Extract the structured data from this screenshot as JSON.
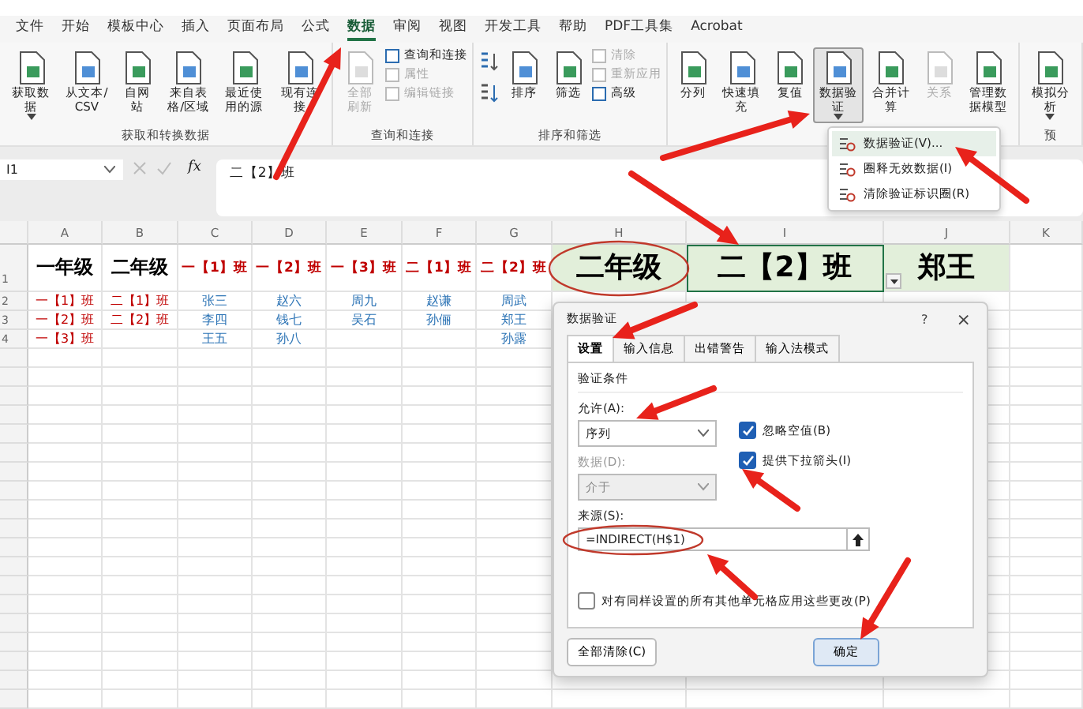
{
  "menu_tabs": [
    {
      "label": "文件",
      "selected": false
    },
    {
      "label": "开始",
      "selected": false
    },
    {
      "label": "模板中心",
      "selected": false
    },
    {
      "label": "插入",
      "selected": false
    },
    {
      "label": "页面布局",
      "selected": false
    },
    {
      "label": "公式",
      "selected": false
    },
    {
      "label": "数据",
      "selected": true
    },
    {
      "label": "审阅",
      "selected": false
    },
    {
      "label": "视图",
      "selected": false
    },
    {
      "label": "开发工具",
      "selected": false
    },
    {
      "label": "帮助",
      "selected": false
    },
    {
      "label": "PDF工具集",
      "selected": false
    },
    {
      "label": "Acrobat",
      "selected": false
    }
  ],
  "ribbon": {
    "groups": [
      {
        "label": "获取和转换数据",
        "buttons": [
          {
            "kind": "large",
            "label": "获取数据",
            "dropdown": true,
            "disabled": false,
            "selected": false
          },
          {
            "kind": "large",
            "label": "从文本/CSV",
            "dropdown": false,
            "disabled": false,
            "selected": false
          },
          {
            "kind": "large",
            "label": "自网站",
            "dropdown": false,
            "disabled": false,
            "selected": false
          },
          {
            "kind": "large",
            "label": "来自表格/区域",
            "dropdown": false,
            "disabled": false,
            "selected": false
          },
          {
            "kind": "large",
            "label": "最近使用的源",
            "dropdown": false,
            "disabled": false,
            "selected": false
          },
          {
            "kind": "large",
            "label": "现有连接",
            "dropdown": false,
            "disabled": false,
            "selected": false
          }
        ]
      },
      {
        "label": "查询和连接",
        "buttons": [
          {
            "kind": "large",
            "label": "全部刷新",
            "dropdown": false,
            "disabled": true,
            "selected": false
          },
          {
            "kind": "stack",
            "items": [
              {
                "label": "查询和连接",
                "disabled": false
              },
              {
                "label": "属性",
                "disabled": true
              },
              {
                "label": "编辑链接",
                "disabled": true
              }
            ]
          }
        ]
      },
      {
        "label": "排序和筛选",
        "buttons": [
          {
            "kind": "sort"
          },
          {
            "kind": "large",
            "label": "排序",
            "dropdown": false,
            "disabled": false,
            "selected": false
          },
          {
            "kind": "large",
            "label": "筛选",
            "dropdown": false,
            "disabled": false,
            "selected": false
          },
          {
            "kind": "stack",
            "items": [
              {
                "label": "清除",
                "disabled": true
              },
              {
                "label": "重新应用",
                "disabled": true
              },
              {
                "label": "高级",
                "disabled": false
              }
            ]
          }
        ]
      },
      {
        "buttons": [
          {
            "kind": "large",
            "label": "分列",
            "dropdown": false,
            "disabled": false,
            "selected": false
          },
          {
            "kind": "large",
            "label": "快速填充",
            "dropdown": false,
            "disabled": false,
            "selected": false
          },
          {
            "kind": "large",
            "label": "复值",
            "dropdown": false,
            "disabled": false,
            "selected": false
          },
          {
            "kind": "large",
            "label": "数据验证",
            "dropdown": true,
            "disabled": false,
            "selected": true
          },
          {
            "kind": "large",
            "label": "合并计算",
            "dropdown": false,
            "disabled": false,
            "selected": false
          },
          {
            "kind": "large",
            "label": "关系",
            "dropdown": false,
            "disabled": true,
            "selected": false
          },
          {
            "kind": "large",
            "label": "管理数据模型",
            "dropdown": false,
            "disabled": false,
            "selected": false
          }
        ]
      },
      {
        "label": "预",
        "buttons": [
          {
            "kind": "large",
            "label": "模拟分析",
            "dropdown": true,
            "disabled": false,
            "selected": false
          }
        ]
      }
    ]
  },
  "validation_menu": [
    {
      "label": "数据验证(V)...",
      "selected": true
    },
    {
      "label": "圈释无效数据(I)",
      "selected": false
    },
    {
      "label": "清除验证标识圈(R)",
      "selected": false
    }
  ],
  "formula_bar": {
    "name_box": "I1",
    "function_label": "fx",
    "value": "二【2】班"
  },
  "sheet": {
    "columns": [
      {
        "letter": "A",
        "color": "#c00000"
      },
      {
        "letter": "B",
        "color": "#c00000"
      },
      {
        "letter": "C",
        "color": "#2e75b6"
      },
      {
        "letter": "D",
        "color": "#2e75b6"
      },
      {
        "letter": "E",
        "color": "#2e75b6"
      },
      {
        "letter": "F",
        "color": "#2e75b6"
      },
      {
        "letter": "G",
        "color": "#2e75b6"
      },
      {
        "letter": "H"
      },
      {
        "letter": "I"
      },
      {
        "letter": "J"
      },
      {
        "letter": "K"
      }
    ],
    "header_row": {
      "number": "1",
      "cells": [
        {
          "text": "一年级",
          "color": "#000000",
          "highlighted": false,
          "selected": false
        },
        {
          "text": "二年级",
          "color": "#000000",
          "highlighted": false,
          "selected": false
        },
        {
          "text": "一【1】班",
          "color": "#c00000",
          "highlighted": false,
          "selected": false
        },
        {
          "text": "一【2】班",
          "color": "#c00000",
          "highlighted": false,
          "selected": false
        },
        {
          "text": "一【3】班",
          "color": "#c00000",
          "highlighted": false,
          "selected": false
        },
        {
          "text": "二【1】班",
          "color": "#c00000",
          "highlighted": false,
          "selected": false
        },
        {
          "text": "二【2】班",
          "color": "#c00000",
          "highlighted": false,
          "selected": false
        },
        {
          "text": "二年级",
          "color": "#000000",
          "highlighted": true,
          "selected": false
        },
        {
          "text": "二【2】班",
          "color": "#000000",
          "highlighted": true,
          "selected": true
        },
        {
          "text": "郑王",
          "color": "#000000",
          "highlighted": true,
          "selected": false
        }
      ]
    },
    "rows": [
      {
        "number": "2",
        "cells": [
          "一【1】班",
          "二【1】班",
          "张三",
          "赵六",
          "周九",
          "赵谦",
          "周武"
        ]
      },
      {
        "number": "3",
        "cells": [
          "一【2】班",
          "二【2】班",
          "李四",
          "钱七",
          "吴石",
          "孙俪",
          "郑王"
        ]
      },
      {
        "number": "4",
        "cells": [
          "一【3】班",
          null,
          "王五",
          "孙八",
          null,
          null,
          "孙露"
        ]
      }
    ]
  },
  "dialog": {
    "title": "数据验证",
    "help": "?",
    "close": "×",
    "tabs": [
      {
        "label": "设置",
        "selected": true
      },
      {
        "label": "输入信息",
        "selected": false
      },
      {
        "label": "出错警告",
        "selected": false
      },
      {
        "label": "输入法模式",
        "selected": false
      }
    ],
    "section": "验证条件",
    "allow": {
      "label": "允许(A):",
      "value": "序列"
    },
    "data": {
      "label": "数据(D):",
      "value": "介于",
      "disabled": true
    },
    "checkboxes": [
      {
        "label": "忽略空值(B)",
        "checked": true
      },
      {
        "label": "提供下拉箭头(I)",
        "checked": true
      }
    ],
    "source": {
      "label": "来源(S):",
      "value": "=INDIRECT(H$1)"
    },
    "apply_all": {
      "label": "对有同样设置的所有其他单元格应用这些更改(P)",
      "checked": false
    },
    "buttons": [
      {
        "label": "全部清除(C)",
        "kind": "secondary"
      },
      {
        "label": "确定",
        "kind": "primary"
      }
    ]
  }
}
